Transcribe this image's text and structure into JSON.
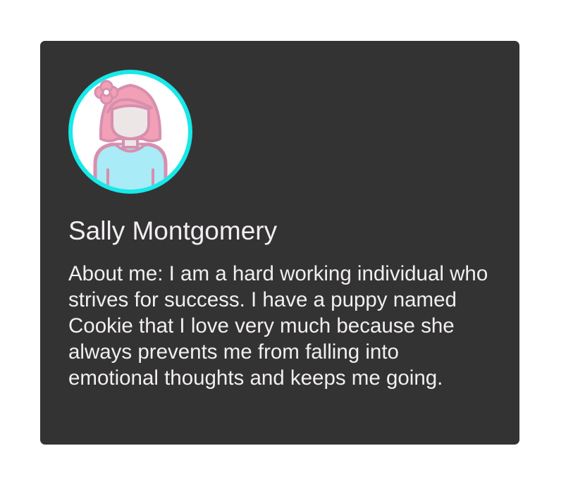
{
  "profile": {
    "name": "Sally Montgomery",
    "about": "About me: I am a hard working individual who strives for success. I have a puppy named Cookie that I love very much because she always prevents me from falling into emotional thoughts and keeps me going.",
    "avatar_icon": "woman-avatar-icon"
  },
  "colors": {
    "card_background": "#333333",
    "avatar_ring": "#18e8e8",
    "text": "#f2eef2",
    "hair": "#f1a0b6",
    "shirt": "#a9ebf6"
  }
}
